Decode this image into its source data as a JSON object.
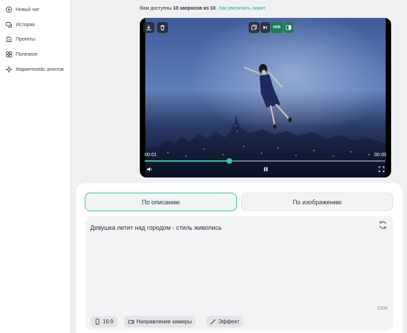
{
  "sidebar": {
    "items": [
      {
        "label": "Новый чат",
        "icon": "plus-circle-icon"
      },
      {
        "label": "История",
        "icon": "chat-history-icon"
      },
      {
        "label": "Проекты",
        "icon": "projects-icon"
      },
      {
        "label": "Полезное",
        "icon": "grid-icon"
      },
      {
        "label": "Маркетплейс агентов",
        "icon": "sparkle-icon"
      }
    ]
  },
  "limit": {
    "prefix": "Вам доступны ",
    "bold": "10 запросов из 10",
    "suffix": ".",
    "link": "Как увеличить лимит"
  },
  "player": {
    "hd_label": "HDR",
    "current_time": "00:01",
    "duration": "00:05",
    "progress": 0.35
  },
  "tabs": {
    "by_description": "По описанию",
    "by_image": "По изображению"
  },
  "prompt": {
    "text": "Девушка летит над городом - стиль живопись",
    "char_count": "2006"
  },
  "chips": {
    "aspect": "16:9",
    "camera": "Направление камеры",
    "effect": "Эффект"
  },
  "colors": {
    "accent": "#34c59b",
    "link": "#19b394"
  }
}
